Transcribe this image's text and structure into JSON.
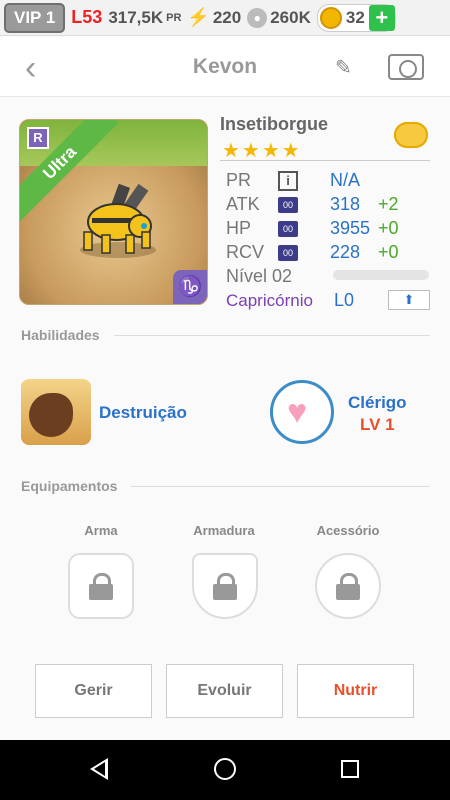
{
  "status": {
    "vip": "VIP 1",
    "level": "L53",
    "pr": "317,5K",
    "pr_unit": "PR",
    "energy": "220",
    "food": "260K",
    "coins": "32",
    "add": "+"
  },
  "header": {
    "title": "Kevon"
  },
  "monster": {
    "card_rarity": "Ultra",
    "card_badge": "R",
    "name": "Insetiborgue",
    "stars": "★★★★",
    "zodiac_glyph": "♑",
    "stats": [
      {
        "label": "PR",
        "icon": "i",
        "value": "N/A",
        "bonus": ""
      },
      {
        "label": "ATK",
        "icon": "00",
        "value": "318",
        "bonus": "+2"
      },
      {
        "label": "HP",
        "icon": "00",
        "value": "3955",
        "bonus": "+0"
      },
      {
        "label": "RCV",
        "icon": "00",
        "value": "228",
        "bonus": "+0"
      }
    ],
    "level_label": "Nível 02",
    "level_progress": 0,
    "sign": "Capricórnio",
    "sign_level": "L0"
  },
  "skills": {
    "section_title": "Habilidades",
    "active_name": "Destruição",
    "leader_name": "Clérigo",
    "leader_level": "LV 1"
  },
  "equipment": {
    "section_title": "Equipamentos",
    "slots": [
      "Arma",
      "Armadura",
      "Acessório"
    ]
  },
  "actions": {
    "manage": "Gerir",
    "evolve": "Evoluir",
    "feed": "Nutrir"
  },
  "colors": {
    "accent_blue": "#2a72c9",
    "accent_orange": "#e8502a",
    "bonus_green": "#4aa82d"
  }
}
